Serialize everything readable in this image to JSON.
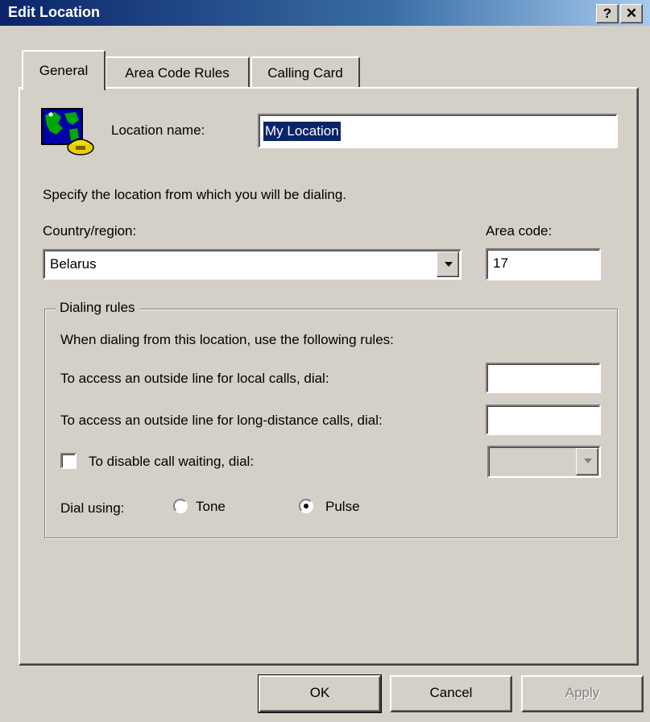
{
  "window": {
    "title": "Edit Location",
    "help_label": "?",
    "close_label": "✕"
  },
  "tabs": [
    {
      "label": "General",
      "active": true
    },
    {
      "label": "Area Code Rules",
      "active": false
    },
    {
      "label": "Calling Card",
      "active": false
    }
  ],
  "general": {
    "icon": "globe-phone-icon",
    "location_name_label": "Location name:",
    "location_name_value": "My Location",
    "instruction": "Specify the location from which you will be dialing.",
    "country_label": "Country/region:",
    "country_value": "Belarus",
    "area_code_label": "Area code:",
    "area_code_value": "17"
  },
  "dialing_rules": {
    "group_label": "Dialing rules",
    "intro": "When dialing from this location, use the following rules:",
    "local_label": "To access an outside line for local calls, dial:",
    "local_value": "",
    "long_distance_label": "To access an outside line for long-distance calls, dial:",
    "long_distance_value": "",
    "call_waiting_label": "To disable call waiting, dial:",
    "call_waiting_checked": false,
    "call_waiting_value": "",
    "dial_using_label": "Dial using:",
    "tone_label": "Tone",
    "pulse_label": "Pulse",
    "selected": "Pulse"
  },
  "buttons": {
    "ok": "OK",
    "cancel": "Cancel",
    "apply": "Apply"
  },
  "colors": {
    "face": "#d4d0c8",
    "title_start": "#0a246a",
    "title_end": "#a6caf0",
    "selection": "#0a246a"
  }
}
